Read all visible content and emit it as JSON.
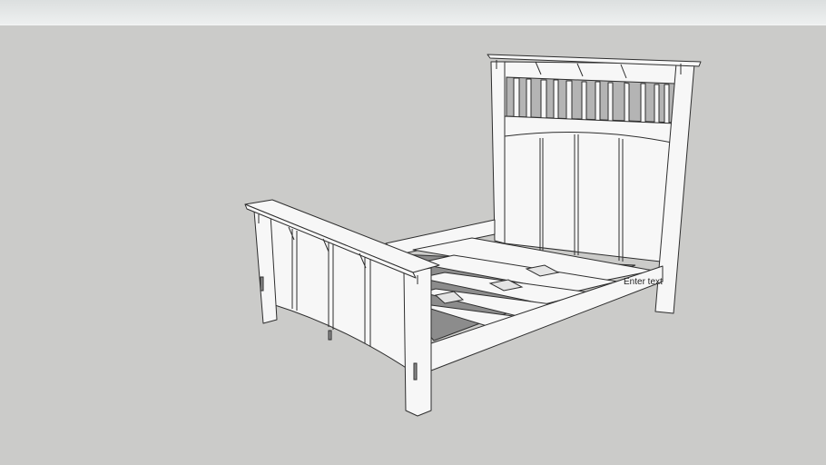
{
  "viewport": {
    "sky_color": "#e6e8e8",
    "ground_color": "#cbcbc9"
  },
  "model": {
    "subject": "bed-frame",
    "label_text": "Enter text"
  }
}
